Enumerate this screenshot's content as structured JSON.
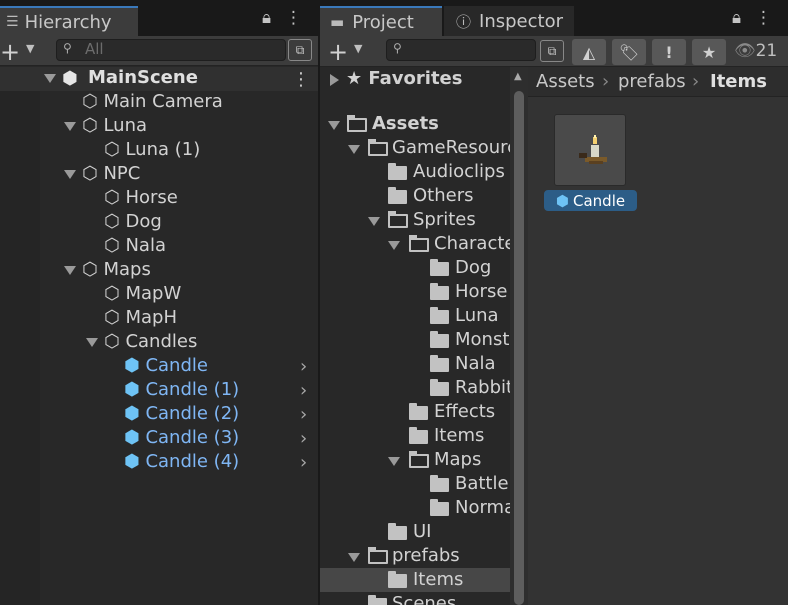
{
  "hierarchy": {
    "tab_label": "Hierarchy",
    "search_placeholder": "All",
    "scene_name": "MainScene",
    "items": [
      {
        "label": "Main Camera"
      },
      {
        "label": "Luna"
      },
      {
        "label": "Luna (1)"
      },
      {
        "label": "NPC"
      },
      {
        "label": "Horse"
      },
      {
        "label": "Dog"
      },
      {
        "label": "Nala"
      },
      {
        "label": "Maps"
      },
      {
        "label": "MapW"
      },
      {
        "label": "MapH"
      },
      {
        "label": "Candles"
      },
      {
        "label": "Candle"
      },
      {
        "label": "Candle (1)"
      },
      {
        "label": "Candle (2)"
      },
      {
        "label": "Candle (3)"
      },
      {
        "label": "Candle (4)"
      }
    ]
  },
  "project": {
    "tab_label": "Project",
    "inspector_tab_label": "Inspector",
    "hidden_count": "21",
    "favorites_label": "Favorites",
    "tree": [
      {
        "label": "Assets"
      },
      {
        "label": "GameResources"
      },
      {
        "label": "Audioclips"
      },
      {
        "label": "Others"
      },
      {
        "label": "Sprites"
      },
      {
        "label": "Characters"
      },
      {
        "label": "Dog"
      },
      {
        "label": "Horse"
      },
      {
        "label": "Luna"
      },
      {
        "label": "Monsters"
      },
      {
        "label": "Nala"
      },
      {
        "label": "Rabbit"
      },
      {
        "label": "Effects"
      },
      {
        "label": "Items"
      },
      {
        "label": "Maps"
      },
      {
        "label": "Battle"
      },
      {
        "label": "Normal"
      },
      {
        "label": "UI"
      },
      {
        "label": "prefabs"
      },
      {
        "label": "Items"
      },
      {
        "label": "Scenes"
      }
    ],
    "breadcrumb": [
      "Assets",
      "prefabs",
      "Items"
    ],
    "asset": {
      "label": "Candle"
    }
  },
  "colors": {
    "accent": "#3a79bb",
    "prefab_blue": "#7fb6f4",
    "selection": "#2c5d87"
  }
}
